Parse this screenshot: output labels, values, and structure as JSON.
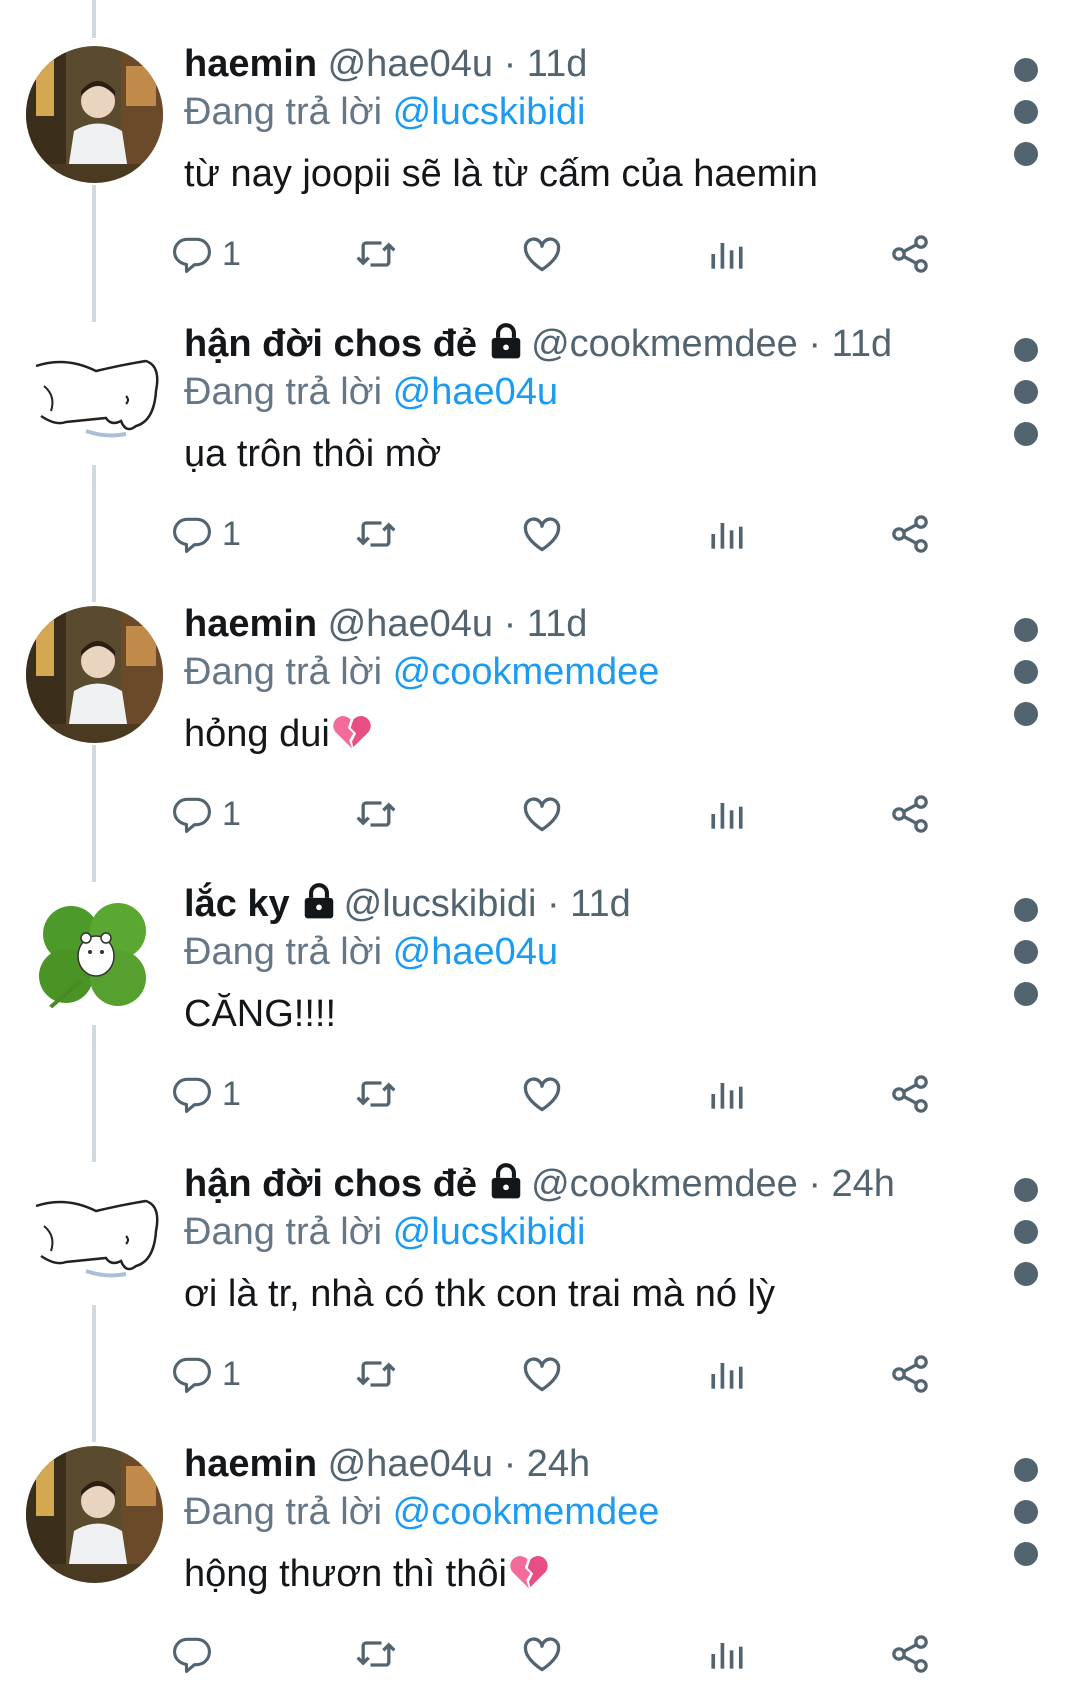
{
  "tweets": [
    {
      "name": "haemin",
      "handle": "@hae04u",
      "time": "· 11d",
      "locked": false,
      "reply_prefix": "Đang trả lời",
      "reply_to": "@lucskibidi",
      "text": "từ nay joopii sẽ là từ cấm của haemin",
      "emoji": "",
      "reply_count": "1",
      "avatar": "haemin-photo"
    },
    {
      "name": "hận đời chos đẻ",
      "handle": "@cookmemdee",
      "time": "· 11d",
      "locked": true,
      "reply_prefix": "Đang trả lời",
      "reply_to": "@hae04u",
      "text": "ụa trôn thôi mờ",
      "emoji": "",
      "reply_count": "1",
      "avatar": "dog-sketch"
    },
    {
      "name": "haemin",
      "handle": "@hae04u",
      "time": "· 11d",
      "locked": false,
      "reply_prefix": "Đang trả lời",
      "reply_to": "@cookmemdee",
      "text": "hỏng dui",
      "emoji": "broken-heart",
      "reply_count": "1",
      "avatar": "haemin-photo"
    },
    {
      "name": "lắc ky",
      "handle": "@lucskibidi",
      "time": "· 11d",
      "locked": true,
      "reply_prefix": "Đang trả lời",
      "reply_to": "@hae04u",
      "text": "CĂNG!!!!",
      "emoji": "",
      "reply_count": "1",
      "avatar": "clover"
    },
    {
      "name": "hận đời chos đẻ",
      "handle": "@cookmemdee",
      "time": "· 24h",
      "locked": true,
      "reply_prefix": "Đang trả lời",
      "reply_to": "@lucskibidi",
      "text": "ơi là tr, nhà có thk con trai mà nó lỳ",
      "emoji": "",
      "reply_count": "1",
      "avatar": "dog-sketch"
    },
    {
      "name": "haemin",
      "handle": "@hae04u",
      "time": "· 24h",
      "locked": false,
      "reply_prefix": "Đang trả lời",
      "reply_to": "@cookmemdee",
      "text": "hộng thươn thì thôi",
      "emoji": "broken-heart",
      "reply_count": "",
      "avatar": "haemin-photo"
    }
  ],
  "colors": {
    "mention": "#1d9bf0",
    "icon": "#536471",
    "thread_line": "#cfd9de"
  }
}
